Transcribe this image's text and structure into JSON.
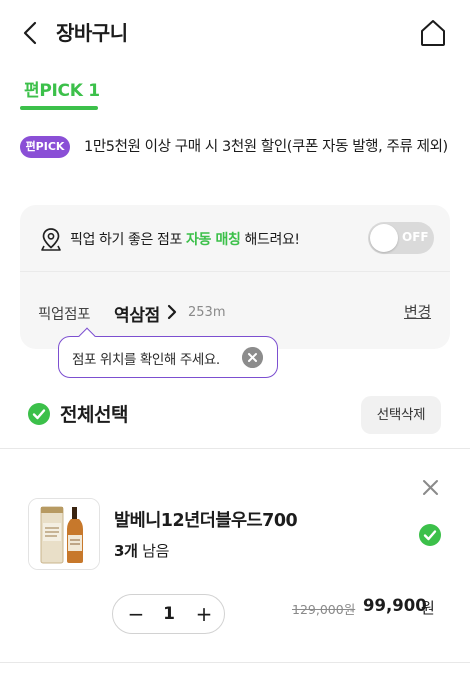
{
  "header": {
    "title": "장바구니",
    "back_icon": "chevron-left-icon",
    "home_icon": "home-icon"
  },
  "tab": {
    "label": "편PICK 1"
  },
  "promo": {
    "badge": "편PICK",
    "text": "1만5천원 이상 구매 시 3천원 할인(쿠폰 자동 발행, 주류 제외)"
  },
  "pickup": {
    "text_pre": "픽업 하기 좋은 점포 ",
    "text_highlight": "자동 매칭",
    "text_post": " 해드려요!",
    "toggle_label": "OFF",
    "store_label": "픽업점포",
    "store_name": "역삼점",
    "distance": "253m",
    "change_label": "변경"
  },
  "tooltip": {
    "text": "점포 위치를 확인해 주세요."
  },
  "selection": {
    "select_all_label": "전체선택",
    "delete_selected_label": "선택삭제"
  },
  "item": {
    "name": "발베니12년더블우드700",
    "stock_count": "3개",
    "stock_suffix": " 남음",
    "quantity": "1",
    "original_price": "129,000원",
    "sale_price": "99,900",
    "currency": "원"
  },
  "colors": {
    "accent_green": "#3cc04a",
    "accent_purple": "#8a4fd6"
  }
}
